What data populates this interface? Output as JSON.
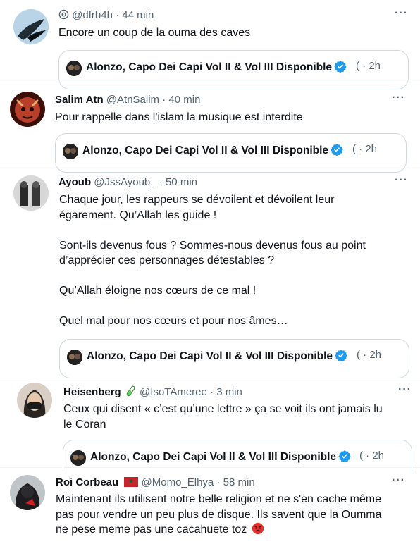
{
  "tweets": [
    {
      "name": "",
      "handle": "@dfrb4h",
      "time": "44 min",
      "prefix_icon": "settings-badge-icon",
      "body": [
        "Encore un coup de la ouma des caves"
      ],
      "quote": {
        "name": "Alonzo, Capo Dei Capi Vol II & Vol III Disponible",
        "time": "2h"
      }
    },
    {
      "name": "Salim Atn",
      "handle": "@AtnSalim",
      "time": "40 min",
      "body": [
        "Pour rappelle dans l'islam la musique est interdite"
      ],
      "quote": {
        "name": "Alonzo, Capo Dei Capi Vol II & Vol III Disponible",
        "time": "2h"
      }
    },
    {
      "name": "Ayoub",
      "handle": "@JssAyoub_",
      "time": "50 min",
      "body": [
        "Chaque jour, les rappeurs se dévoilent et dévoilent leur",
        "égarement. Qu’Allah les guide !",
        "",
        "Sont-ils devenus fous ? Sommes-nous devenus fous au point",
        "d’apprécier ces personnages détestables ?",
        "",
        "Qu’Allah éloigne nos cœurs de ce mal !",
        "",
        "Quel mal pour nos cœurs et pour nos âmes…"
      ],
      "quote": {
        "name": "Alonzo, Capo Dei Capi Vol II & Vol III Disponible",
        "time": "2h"
      }
    },
    {
      "name": "Heisenberg",
      "name_emoji": "test-tube-icon",
      "handle": "@IsoTAmeree",
      "time": "3 min",
      "body": [
        "Ceux qui disent « c’est qu’une lettre » ça se voit ils ont jamais lu",
        "le Coran"
      ],
      "quote": {
        "name": "Alonzo, Capo Dei Capi Vol II & Vol III Disponible",
        "time": "2h"
      }
    },
    {
      "name": "Roi Corbeau",
      "name_emoji": "morocco-flag-icon",
      "handle": "@Momo_Elhya",
      "time": "58 min",
      "body": [
        "Maintenant ils utilisent notre belle religion et ne s'en cache même",
        "pas pour vendre un peu plus de disque. Ils savent que la Oumma",
        "ne pese meme pas une cacahuete toz"
      ],
      "body_end_emoji": "angry-face-icon"
    }
  ],
  "colors": {
    "verified": "#1d9bf0",
    "secondary_text": "#536471",
    "border": "#cfd9de",
    "flag": "#c1272d",
    "angry": "#e0312a"
  }
}
